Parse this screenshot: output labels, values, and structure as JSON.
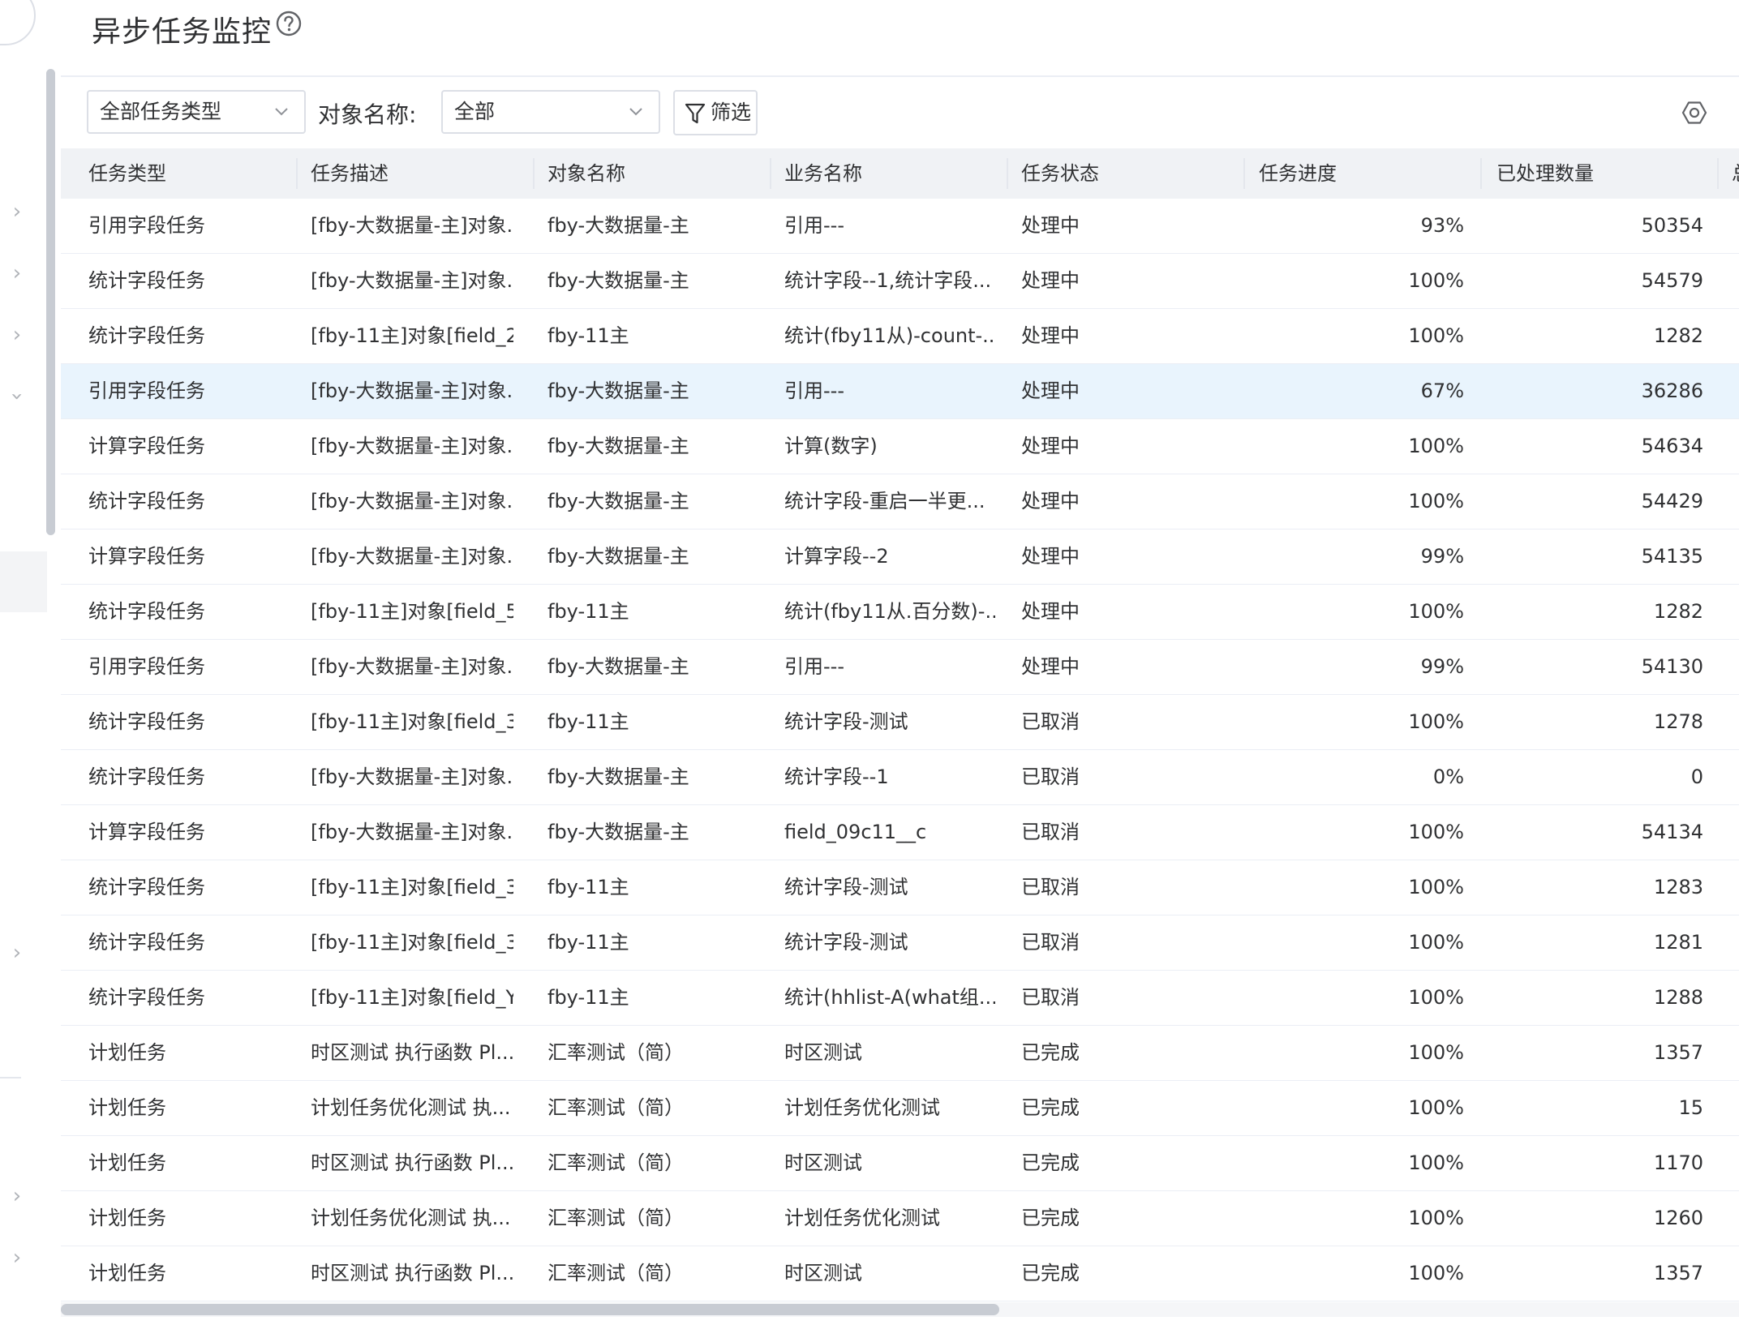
{
  "header": {
    "title": "异步任务监控",
    "help_icon": "question-circle-icon"
  },
  "toolbar": {
    "task_type_select": "全部任务类型",
    "object_label": "对象名称:",
    "object_select": "全部",
    "filter_label": "筛选",
    "settings_icon": "settings-hexagon-icon"
  },
  "table": {
    "columns": [
      "任务类型",
      "任务描述",
      "对象名称",
      "业务名称",
      "任务状态",
      "任务进度",
      "已处理数量",
      "总"
    ],
    "rows": [
      [
        "引用字段任务",
        "[fby-大数据量-主]对象...",
        "fby-大数据量-主",
        "引用---",
        "处理中",
        "93%",
        "50354"
      ],
      [
        "统计字段任务",
        "[fby-大数据量-主]对象...",
        "fby-大数据量-主",
        "统计字段--1,统计字段...",
        "处理中",
        "100%",
        "54579"
      ],
      [
        "统计字段任务",
        "[fby-11主]对象[field_2...",
        "fby-11主",
        "统计(fby11从)-count-...",
        "处理中",
        "100%",
        "1282"
      ],
      [
        "引用字段任务",
        "[fby-大数据量-主]对象...",
        "fby-大数据量-主",
        "引用---",
        "处理中",
        "67%",
        "36286"
      ],
      [
        "计算字段任务",
        "[fby-大数据量-主]对象...",
        "fby-大数据量-主",
        "计算(数字)",
        "处理中",
        "100%",
        "54634"
      ],
      [
        "统计字段任务",
        "[fby-大数据量-主]对象...",
        "fby-大数据量-主",
        "统计字段-重启一半更...",
        "处理中",
        "100%",
        "54429"
      ],
      [
        "计算字段任务",
        "[fby-大数据量-主]对象...",
        "fby-大数据量-主",
        "计算字段--2",
        "处理中",
        "99%",
        "54135"
      ],
      [
        "统计字段任务",
        "[fby-11主]对象[field_5...",
        "fby-11主",
        "统计(fby11从.百分数)-...",
        "处理中",
        "100%",
        "1282"
      ],
      [
        "引用字段任务",
        "[fby-大数据量-主]对象...",
        "fby-大数据量-主",
        "引用---",
        "处理中",
        "99%",
        "54130"
      ],
      [
        "统计字段任务",
        "[fby-11主]对象[field_3...",
        "fby-11主",
        "统计字段-测试",
        "已取消",
        "100%",
        "1278"
      ],
      [
        "统计字段任务",
        "[fby-大数据量-主]对象...",
        "fby-大数据量-主",
        "统计字段--1",
        "已取消",
        "0%",
        "0"
      ],
      [
        "计算字段任务",
        "[fby-大数据量-主]对象...",
        "fby-大数据量-主",
        "field_09c11__c",
        "已取消",
        "100%",
        "54134"
      ],
      [
        "统计字段任务",
        "[fby-11主]对象[field_3...",
        "fby-11主",
        "统计字段-测试",
        "已取消",
        "100%",
        "1283"
      ],
      [
        "统计字段任务",
        "[fby-11主]对象[field_3...",
        "fby-11主",
        "统计字段-测试",
        "已取消",
        "100%",
        "1281"
      ],
      [
        "统计字段任务",
        "[fby-11主]对象[field_Y...",
        "fby-11主",
        "统计(hhlist-A(what组...",
        "已取消",
        "100%",
        "1288"
      ],
      [
        "计划任务",
        "时区测试 执行函数 Pl...",
        "汇率测试（简）",
        "时区测试",
        "已完成",
        "100%",
        "1357"
      ],
      [
        "计划任务",
        "计划任务优化测试 执...",
        "汇率测试（简）",
        "计划任务优化测试",
        "已完成",
        "100%",
        "15"
      ],
      [
        "计划任务",
        "时区测试 执行函数 Pl...",
        "汇率测试（简）",
        "时区测试",
        "已完成",
        "100%",
        "1170"
      ],
      [
        "计划任务",
        "计划任务优化测试 执...",
        "汇率测试（简）",
        "计划任务优化测试",
        "已完成",
        "100%",
        "1260"
      ],
      [
        "计划任务",
        "时区测试 执行函数 Pl...",
        "汇率测试（简）",
        "时区测试",
        "已完成",
        "100%",
        "1357"
      ]
    ],
    "highlighted_row": 3
  },
  "colors": {
    "accent": "#409eff",
    "row_highlight": "#e9f4fd",
    "header_bg": "#f0f2f5",
    "border": "#dcdfe6"
  }
}
